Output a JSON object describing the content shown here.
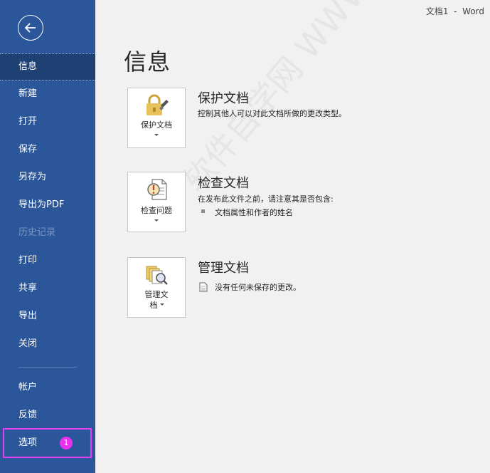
{
  "window": {
    "title": "文档1  -  Word"
  },
  "colors": {
    "sidebar": "#2b579a",
    "highlight": "#e43ff0",
    "badge": "#e632ee"
  },
  "sidebar": {
    "back_icon": "arrow-left-circle-icon",
    "items": [
      {
        "label": "信息",
        "state": "active"
      },
      {
        "label": "新建"
      },
      {
        "label": "打开"
      },
      {
        "label": "保存"
      },
      {
        "label": "另存为"
      },
      {
        "label": "导出为PDF"
      },
      {
        "label": "历史记录",
        "state": "disabled"
      },
      {
        "label": "打印"
      },
      {
        "label": "共享"
      },
      {
        "label": "导出"
      },
      {
        "label": "关闭"
      },
      {
        "label": "帐户"
      },
      {
        "label": "反馈"
      },
      {
        "label": "选项"
      }
    ],
    "badge": "1"
  },
  "main": {
    "title": "信息",
    "sections": [
      {
        "tile_label": "保护文档",
        "tile_icon": "lock-icon",
        "heading": "保护文档",
        "description": "控制其他人可以对此文档所做的更改类型。"
      },
      {
        "tile_label": "检查问题",
        "tile_icon": "inspect-document-icon",
        "heading": "检查文档",
        "description": "在发布此文件之前，请注意其是否包含:",
        "bullets": [
          "文档属性和作者的姓名"
        ]
      },
      {
        "tile_label_line1": "管理文",
        "tile_label_line2": "档",
        "tile_icon": "manage-document-icon",
        "heading": "管理文档",
        "description": "没有任何未保存的更改。",
        "desc_icon": "document-icon"
      }
    ]
  },
  "watermark": "软件自学网 WWW.RJZXW.COM"
}
